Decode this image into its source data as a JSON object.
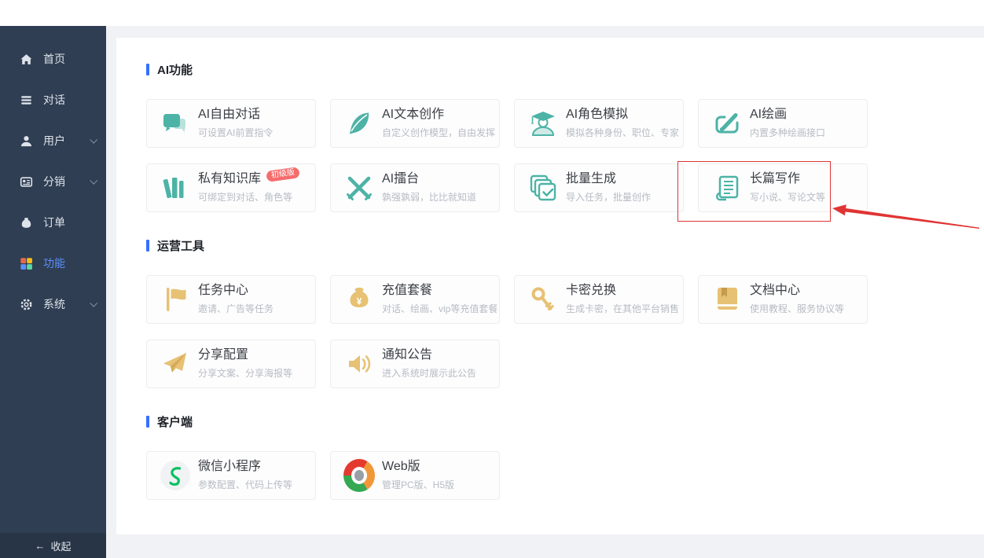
{
  "sidebar": {
    "items": [
      {
        "label": "首页",
        "icon": "home-icon",
        "active": false,
        "has_chevron": false
      },
      {
        "label": "对话",
        "icon": "chat-lines-icon",
        "active": false,
        "has_chevron": false
      },
      {
        "label": "用户",
        "icon": "user-icon",
        "active": false,
        "has_chevron": true
      },
      {
        "label": "分销",
        "icon": "distribution-icon",
        "active": false,
        "has_chevron": true
      },
      {
        "label": "订单",
        "icon": "order-moneybag-icon",
        "active": false,
        "has_chevron": false
      },
      {
        "label": "功能",
        "icon": "colored-grid-icon",
        "active": true,
        "has_chevron": false
      },
      {
        "label": "系统",
        "icon": "gear-icon",
        "active": false,
        "has_chevron": true
      }
    ],
    "collapse_arrow": "←",
    "collapse_label": "收起"
  },
  "sections": [
    {
      "title": "AI功能",
      "cards": [
        {
          "title": "AI自由对话",
          "subtitle": "可设置AI前置指令",
          "icon": "chat-bubbles-icon",
          "tone": "teal"
        },
        {
          "title": "AI文本创作",
          "subtitle": "自定义创作模型，自由发挥",
          "icon": "feather-icon",
          "tone": "teal"
        },
        {
          "title": "AI角色模拟",
          "subtitle": "模拟各种身份、职位、专家",
          "icon": "graduate-icon",
          "tone": "teal"
        },
        {
          "title": "AI绘画",
          "subtitle": "内置多种绘画接口",
          "icon": "paintbrush-icon",
          "tone": "teal"
        },
        {
          "title": "私有知识库",
          "subtitle": "可绑定到对话、角色等",
          "icon": "books-icon",
          "tone": "teal",
          "badge": "初级版"
        },
        {
          "title": "AI擂台",
          "subtitle": "孰强孰弱，比比就知道",
          "icon": "crossed-swords-icon",
          "tone": "teal"
        },
        {
          "title": "批量生成",
          "subtitle": "导入任务，批量创作",
          "icon": "batch-check-icon",
          "tone": "teal"
        },
        {
          "title": "长篇写作",
          "subtitle": "写小说、写论文等",
          "icon": "longform-doc-icon",
          "tone": "teal",
          "highlighted": true
        }
      ]
    },
    {
      "title": "运营工具",
      "cards": [
        {
          "title": "任务中心",
          "subtitle": "邀请、广告等任务",
          "icon": "flag-icon",
          "tone": "gold"
        },
        {
          "title": "充值套餐",
          "subtitle": "对话、绘画、vip等充值套餐",
          "icon": "moneybag-icon",
          "tone": "gold"
        },
        {
          "title": "卡密兑换",
          "subtitle": "生成卡密，在其他平台销售",
          "icon": "key-icon",
          "tone": "gold"
        },
        {
          "title": "文档中心",
          "subtitle": "使用教程、服务协议等",
          "icon": "doc-book-icon",
          "tone": "gold"
        },
        {
          "title": "分享配置",
          "subtitle": "分享文案、分享海报等",
          "icon": "paper-plane-icon",
          "tone": "gold"
        },
        {
          "title": "通知公告",
          "subtitle": "进入系统时展示此公告",
          "icon": "speaker-icon",
          "tone": "gold"
        }
      ]
    },
    {
      "title": "客户端",
      "cards": [
        {
          "title": "微信小程序",
          "subtitle": "参数配置、代码上传等",
          "icon": "wechat-miniprogram-icon",
          "tone": "plain"
        },
        {
          "title": "Web版",
          "subtitle": "管理PC版、H5版",
          "icon": "chrome-icon",
          "tone": "plain"
        }
      ]
    }
  ],
  "colors": {
    "accent": "#3370ff",
    "active_blue": "#5b8ff9",
    "teal": "#4db3a6",
    "gold": "#e7c174",
    "badge_red": "#f56c6c",
    "annotation_red": "#e03434",
    "sidebar_bg": "#2f3e52"
  }
}
